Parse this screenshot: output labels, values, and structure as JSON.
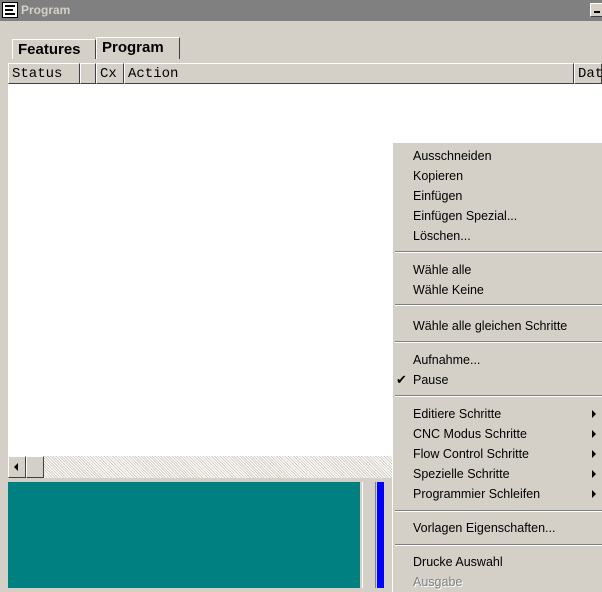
{
  "window": {
    "title": "Program"
  },
  "tabs": [
    {
      "label": "Features"
    },
    {
      "label": "Program"
    }
  ],
  "columns": [
    {
      "label": "Status"
    },
    {
      "label": ""
    },
    {
      "label": "Cx"
    },
    {
      "label": "Action"
    },
    {
      "label": "Dat"
    }
  ],
  "context_menu": {
    "items": [
      {
        "label": "Ausschneiden"
      },
      {
        "label": "Kopieren"
      },
      {
        "label": "Einfügen"
      },
      {
        "label": "Einfügen Spezial..."
      },
      {
        "label": "Löschen..."
      },
      {
        "label": "Wähle alle"
      },
      {
        "label": "Wähle Keine"
      },
      {
        "label": "Wähle alle gleichen Schritte"
      },
      {
        "label": "Aufnahme..."
      },
      {
        "label": "Pause",
        "checked": true,
        "check_glyph": "✔"
      },
      {
        "label": "Editiere Schritte",
        "submenu": true
      },
      {
        "label": "CNC Modus Schritte",
        "submenu": true
      },
      {
        "label": "Flow Control Schritte",
        "submenu": true
      },
      {
        "label": "Spezielle Schritte",
        "submenu": true
      },
      {
        "label": "Programmier Schleifen",
        "submenu": true
      },
      {
        "label": "Vorlagen Eigenschaften..."
      },
      {
        "label": "Drucke Auswahl"
      },
      {
        "label": "Ausgabe",
        "disabled": true
      }
    ]
  },
  "colors": {
    "titlebar_inactive": "#808080",
    "panel": "#008080",
    "accent_strip": "#0000ff",
    "face": "#d4d0c8"
  }
}
